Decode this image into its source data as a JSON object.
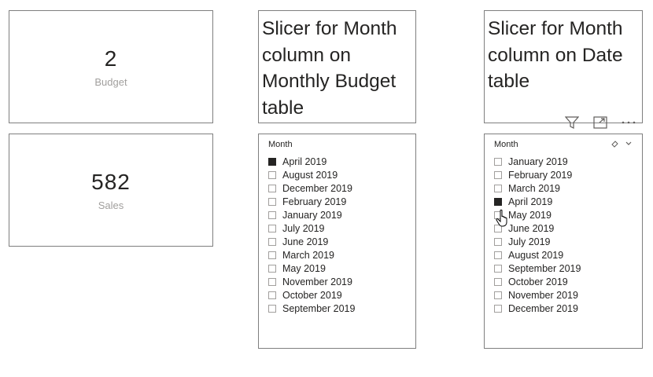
{
  "cards": [
    {
      "value": "2",
      "label": "Budget"
    },
    {
      "value": "582",
      "label": "Sales"
    }
  ],
  "textboxes": [
    {
      "text": "Slicer for Month column on Monthly Budget table"
    },
    {
      "text": "Slicer for Month column on Date table"
    }
  ],
  "slicers": [
    {
      "header": "Month",
      "items": [
        {
          "label": "April 2019",
          "checked": true
        },
        {
          "label": "August 2019",
          "checked": false
        },
        {
          "label": "December 2019",
          "checked": false
        },
        {
          "label": "February 2019",
          "checked": false
        },
        {
          "label": "January 2019",
          "checked": false
        },
        {
          "label": "July 2019",
          "checked": false
        },
        {
          "label": "June 2019",
          "checked": false
        },
        {
          "label": "March 2019",
          "checked": false
        },
        {
          "label": "May 2019",
          "checked": false
        },
        {
          "label": "November 2019",
          "checked": false
        },
        {
          "label": "October 2019",
          "checked": false
        },
        {
          "label": "September 2019",
          "checked": false
        }
      ]
    },
    {
      "header": "Month",
      "items": [
        {
          "label": "January 2019",
          "checked": false
        },
        {
          "label": "February 2019",
          "checked": false
        },
        {
          "label": "March 2019",
          "checked": false
        },
        {
          "label": "April 2019",
          "checked": true
        },
        {
          "label": "May 2019",
          "checked": false
        },
        {
          "label": "June 2019",
          "checked": false
        },
        {
          "label": "July 2019",
          "checked": false
        },
        {
          "label": "August 2019",
          "checked": false
        },
        {
          "label": "September 2019",
          "checked": false
        },
        {
          "label": "October 2019",
          "checked": false
        },
        {
          "label": "November 2019",
          "checked": false
        },
        {
          "label": "December 2019",
          "checked": false
        }
      ],
      "tools": [
        "eraser-icon",
        "chevron-down-icon"
      ]
    }
  ],
  "visual_header_icons": [
    "filter-icon",
    "focus-mode-icon",
    "more-options-icon"
  ]
}
